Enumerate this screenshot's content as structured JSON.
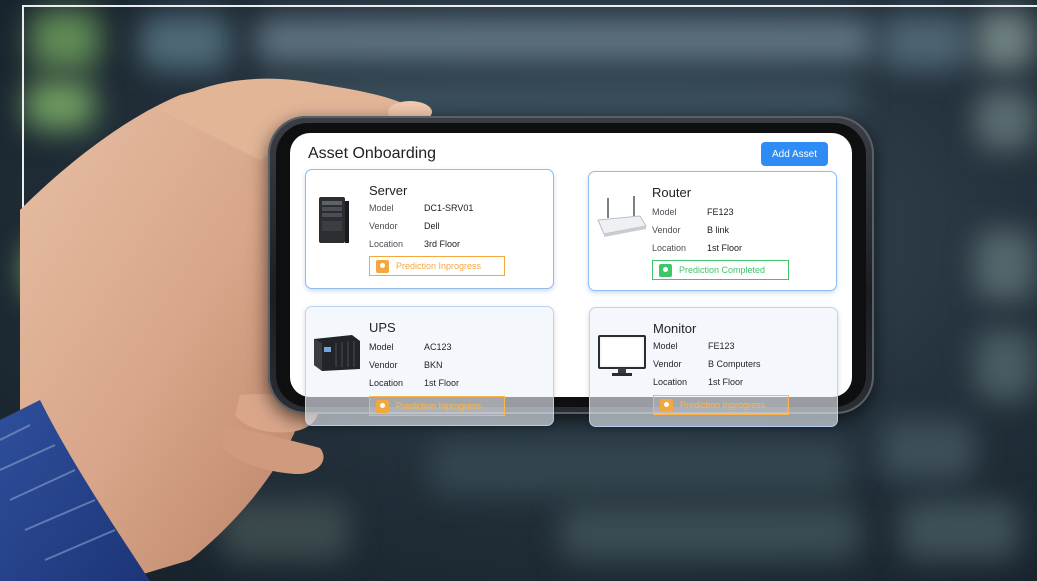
{
  "app": {
    "title": "Asset Onboarding",
    "add_button": "Add Asset"
  },
  "cards": [
    {
      "name": "Server",
      "model_label": "Model",
      "model": "DC1-SRV01",
      "vendor_label": "Vendor",
      "vendor": "Dell",
      "location_label": "Location",
      "location": "3rd Floor",
      "status": "Prediction Inprogress",
      "status_kind": "progress",
      "icon": "server-icon"
    },
    {
      "name": "Router",
      "model_label": "Model",
      "model": "FE123",
      "vendor_label": "Vendor",
      "vendor": "B link",
      "location_label": "Location",
      "location": "1st Floor",
      "status": "Prediction Completed",
      "status_kind": "done",
      "icon": "router-icon"
    },
    {
      "name": "UPS",
      "model_label": "Model",
      "model": "AC123",
      "vendor_label": "Vendor",
      "vendor": "BKN",
      "location_label": "Location",
      "location": "1st Floor",
      "status": "Prediction Inprogress",
      "status_kind": "progress",
      "icon": "ups-icon"
    },
    {
      "name": "Monitor",
      "model_label": "Model",
      "model": "FE123",
      "vendor_label": "Vendor",
      "vendor": "B Computers",
      "location_label": "Location",
      "location": "1st Floor",
      "status": "Prediction Inprogress",
      "status_kind": "progress",
      "icon": "monitor-icon"
    }
  ],
  "colors": {
    "accent": "#2f8cf5",
    "progress": "#f3a83d",
    "completed": "#3fc66b",
    "card_border": "#8fbcf1"
  }
}
